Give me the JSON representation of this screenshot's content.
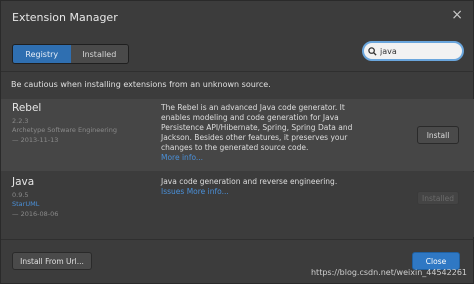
{
  "window": {
    "title": "Extension Manager",
    "close_glyph": "×"
  },
  "tabs": [
    {
      "label": "Registry",
      "active": true
    },
    {
      "label": "Installed",
      "active": false
    }
  ],
  "search": {
    "value": "java",
    "icon": "search-icon"
  },
  "warning": "Be cautious when installing extensions from an unknown source.",
  "extensions": [
    {
      "name": "Rebel",
      "version": "2.2.3",
      "author": "Archetype Software Engineering",
      "date": "— 2013-11-13",
      "description": "The Rebel is an advanced Java code generator. It enables modeling and code generation for Java Persistence API/Hibernate, Spring, Spring Data and Jackson. Besides other features, it preserves your changes to the generated source code.",
      "more_link": "More info...",
      "button": "Install"
    },
    {
      "name": "Java",
      "version": "0.9.5",
      "author": "StarUML",
      "date": "— 2016-08-06",
      "description": "Java code generation and reverse engineering.",
      "issues_link": "Issues",
      "more_link": "More info...",
      "button": "Installed"
    }
  ],
  "footer": {
    "install_url": "Install From Url...",
    "close": "Close"
  },
  "watermark": "https://blog.csdn.net/weixin_44542261"
}
